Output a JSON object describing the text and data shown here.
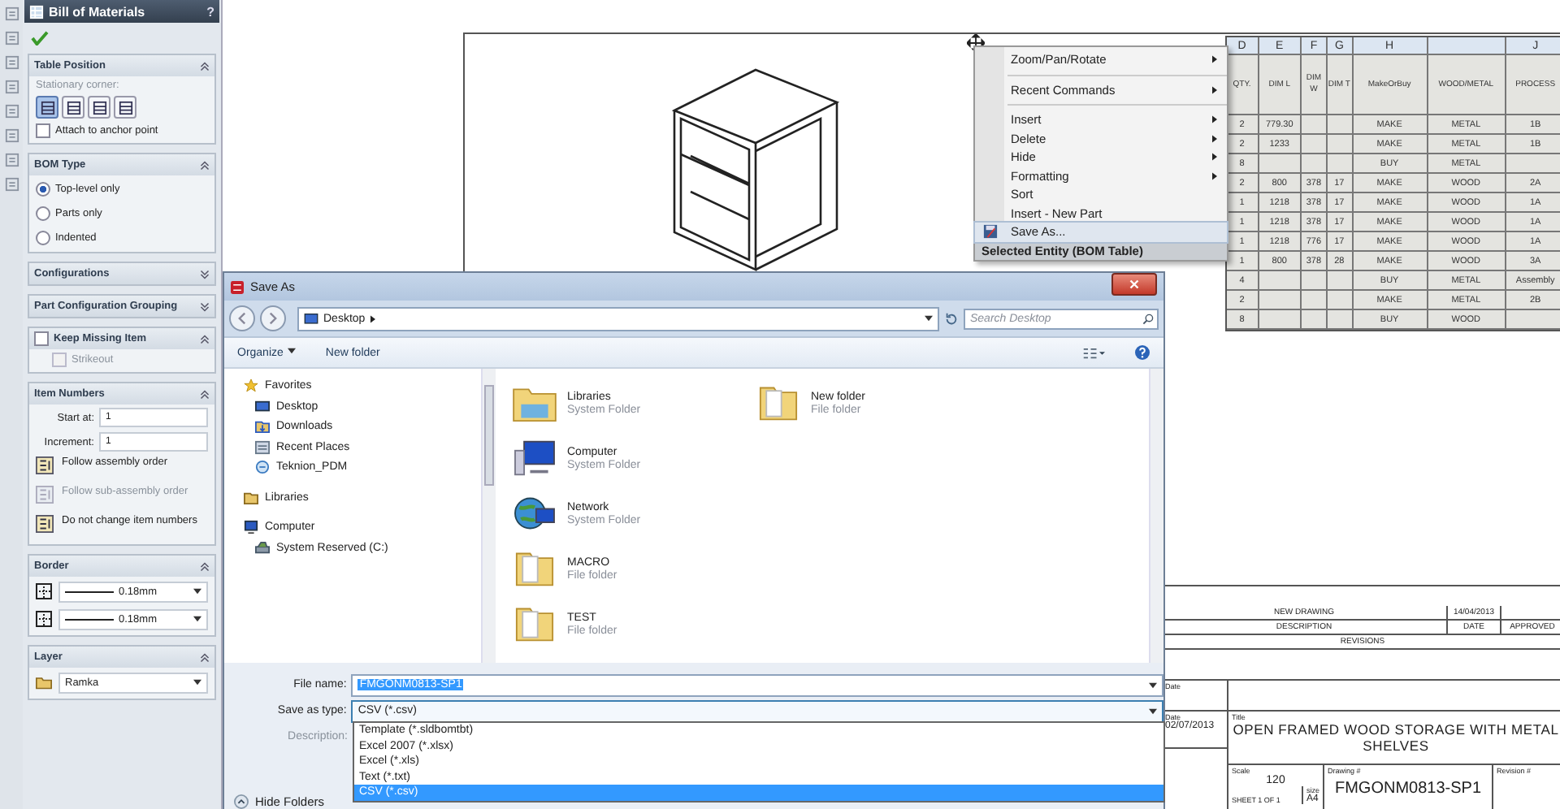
{
  "property_manager": {
    "title": "Bill of Materials",
    "help": "?",
    "sections": [
      {
        "kind": "table_position",
        "title": "Table Position",
        "expanded": true,
        "corner_label": "Stationary corner:",
        "corners": [
          {
            "selected": true
          },
          {
            "selected": false
          },
          {
            "selected": false
          },
          {
            "selected": false
          }
        ],
        "attach": {
          "label": "Attach to anchor point",
          "checked": false
        }
      },
      {
        "kind": "radios",
        "title": "BOM Type",
        "expanded": true,
        "options": [
          {
            "label": "Top-level only",
            "selected": true
          },
          {
            "label": "Parts only",
            "selected": false
          },
          {
            "label": "Indented",
            "selected": false
          }
        ]
      },
      {
        "kind": "configurations",
        "title": "Configurations",
        "expanded": false
      },
      {
        "kind": "grouping",
        "title": "Part Configuration Grouping",
        "expanded": false
      },
      {
        "kind": "keep_missing",
        "title": "Keep Missing Item",
        "expanded": true,
        "checked": false,
        "strikeout": {
          "label": "Strikeout",
          "checked": false,
          "disabled": true
        }
      },
      {
        "kind": "item_numbers",
        "title": "Item Numbers",
        "expanded": true,
        "fields": [
          {
            "label": "Start at:",
            "value": "1"
          },
          {
            "label": "Increment:",
            "value": "1"
          }
        ],
        "options": [
          {
            "label": "Follow assembly order",
            "disabled": false
          },
          {
            "label": "Follow sub-assembly order",
            "disabled": true
          },
          {
            "label": "Do not change item numbers",
            "disabled": false
          }
        ]
      },
      {
        "kind": "border",
        "title": "Border",
        "expanded": true,
        "lines": [
          {
            "value": "0.18mm"
          },
          {
            "value": "0.18mm"
          }
        ]
      },
      {
        "kind": "layer",
        "title": "Layer",
        "expanded": true,
        "value": "Ramka"
      }
    ]
  },
  "bom_table": {
    "columns": [
      {
        "letter": "D",
        "header": "QTY."
      },
      {
        "letter": "E",
        "header": "DIM L"
      },
      {
        "letter": "F",
        "header": "DIM W"
      },
      {
        "letter": "G",
        "header": "DIM T"
      },
      {
        "letter": "H",
        "header": "MakeOrBuy"
      },
      {
        "header": "WOOD/METAL"
      },
      {
        "letter": "J",
        "header": "PROCESS"
      }
    ],
    "rows": [
      [
        "2",
        "779.30",
        null,
        null,
        "MAKE",
        "METAL",
        "1B"
      ],
      [
        "2",
        "1233",
        null,
        null,
        "MAKE",
        "METAL",
        "1B"
      ],
      [
        "8",
        null,
        null,
        null,
        "BUY",
        "METAL",
        null
      ],
      [
        "2",
        "800",
        "378",
        "17",
        "MAKE",
        "WOOD",
        "2A"
      ],
      [
        "1",
        "1218",
        "378",
        "17",
        "MAKE",
        "WOOD",
        "1A"
      ],
      [
        "1",
        "1218",
        "378",
        "17",
        "MAKE",
        "WOOD",
        "1A"
      ],
      [
        "1",
        "1218",
        "776",
        "17",
        "MAKE",
        "WOOD",
        "1A"
      ],
      [
        "1",
        "800",
        "378",
        "28",
        "MAKE",
        "WOOD",
        "3A"
      ],
      [
        "4",
        null,
        null,
        null,
        "BUY",
        "METAL",
        "Assembly"
      ],
      [
        "2",
        null,
        null,
        null,
        "MAKE",
        "METAL",
        "2B"
      ],
      [
        "8",
        null,
        null,
        null,
        "BUY",
        "WOOD",
        null
      ]
    ]
  },
  "context_menu": {
    "items": [
      {
        "kind": "item",
        "label": "Zoom/Pan/Rotate",
        "submenu": true,
        "highlighted": false
      },
      {
        "kind": "separator"
      },
      {
        "kind": "item",
        "label": "Recent Commands",
        "submenu": true,
        "highlighted": false
      },
      {
        "kind": "separator"
      },
      {
        "kind": "item",
        "label": "Insert",
        "submenu": true,
        "highlighted": false
      },
      {
        "kind": "item",
        "label": "Delete",
        "submenu": true,
        "highlighted": false
      },
      {
        "kind": "item",
        "label": "Hide",
        "submenu": true,
        "highlighted": false
      },
      {
        "kind": "item",
        "label": "Formatting",
        "submenu": true,
        "highlighted": false
      },
      {
        "kind": "item",
        "label": "Sort",
        "submenu": false,
        "highlighted": false
      },
      {
        "kind": "item",
        "label": "Insert - New Part",
        "submenu": false,
        "highlighted": false
      },
      {
        "kind": "icon_item",
        "label": "Save As...",
        "submenu": false,
        "highlighted": true
      },
      {
        "kind": "header",
        "label": "Selected Entity (BOM Table)"
      }
    ]
  },
  "save_dialog": {
    "title": "Save As",
    "address": "Desktop",
    "search": {
      "placeholder": "Search Desktop"
    },
    "toolbar": [
      "Organize",
      "New folder"
    ],
    "nav": [
      {
        "label": "Favorites",
        "kind": "favorites",
        "children": [
          {
            "label": "Desktop",
            "kind": "desktop"
          },
          {
            "label": "Downloads",
            "kind": "downloads"
          },
          {
            "label": "Recent Places",
            "kind": "recent"
          },
          {
            "label": "Teknion_PDM",
            "kind": "pdm"
          }
        ]
      },
      {
        "label": "Libraries",
        "kind": "libraries"
      },
      {
        "label": "Computer",
        "kind": "computer",
        "children": [
          {
            "label": "System Reserved (C:)",
            "kind": "drive"
          }
        ]
      }
    ],
    "items": [
      {
        "name": "Libraries",
        "type": "System Folder",
        "kind": "library"
      },
      {
        "name": "Computer",
        "type": "System Folder",
        "kind": "computer"
      },
      {
        "name": "Network",
        "type": "System Folder",
        "kind": "network"
      },
      {
        "name": "MACRO",
        "type": "File folder",
        "kind": "folder"
      },
      {
        "name": "TEST",
        "type": "File folder",
        "kind": "folder"
      },
      {
        "name": "New folder",
        "type": "File folder",
        "kind": "folder"
      }
    ],
    "file_name": {
      "label": "File name:",
      "value": "FMGONM0813-SP1"
    },
    "save_type": {
      "label": "Save as type:",
      "value": "CSV (*.csv)",
      "options": [
        {
          "label": "Template (*.sldbomtbt)",
          "selected": false
        },
        {
          "label": "Excel 2007 (*.xlsx)",
          "selected": false
        },
        {
          "label": "Excel (*.xls)",
          "selected": false
        },
        {
          "label": "Text (*.txt)",
          "selected": false
        },
        {
          "label": "CSV (*.csv)",
          "selected": true
        }
      ]
    },
    "description_label": "Description:",
    "hide_folders": "Hide Folders"
  },
  "title_block": {
    "revisions": [
      {
        "description": "NEW DRAWING",
        "date": "14/04/2013"
      },
      {
        "description": "DESCRIPTION",
        "date": "DATE",
        "approved": "APPROVED"
      }
    ],
    "revisions_label": "REVISIONS",
    "date_label": "Date",
    "date_label_2": "Date",
    "date": "02/07/2013",
    "title_label": "Title",
    "title": "OPEN FRAMED WOOD STORAGE WITH METAL SHELVES",
    "scale_label": "Scale",
    "scale": "120",
    "sheet": "SHEET 1 OF 1",
    "size_label": "size",
    "size": "A4",
    "drawing_label": "Drawing #",
    "drawing": "FMGONM0813-SP1",
    "revision_label": "Revision #"
  }
}
